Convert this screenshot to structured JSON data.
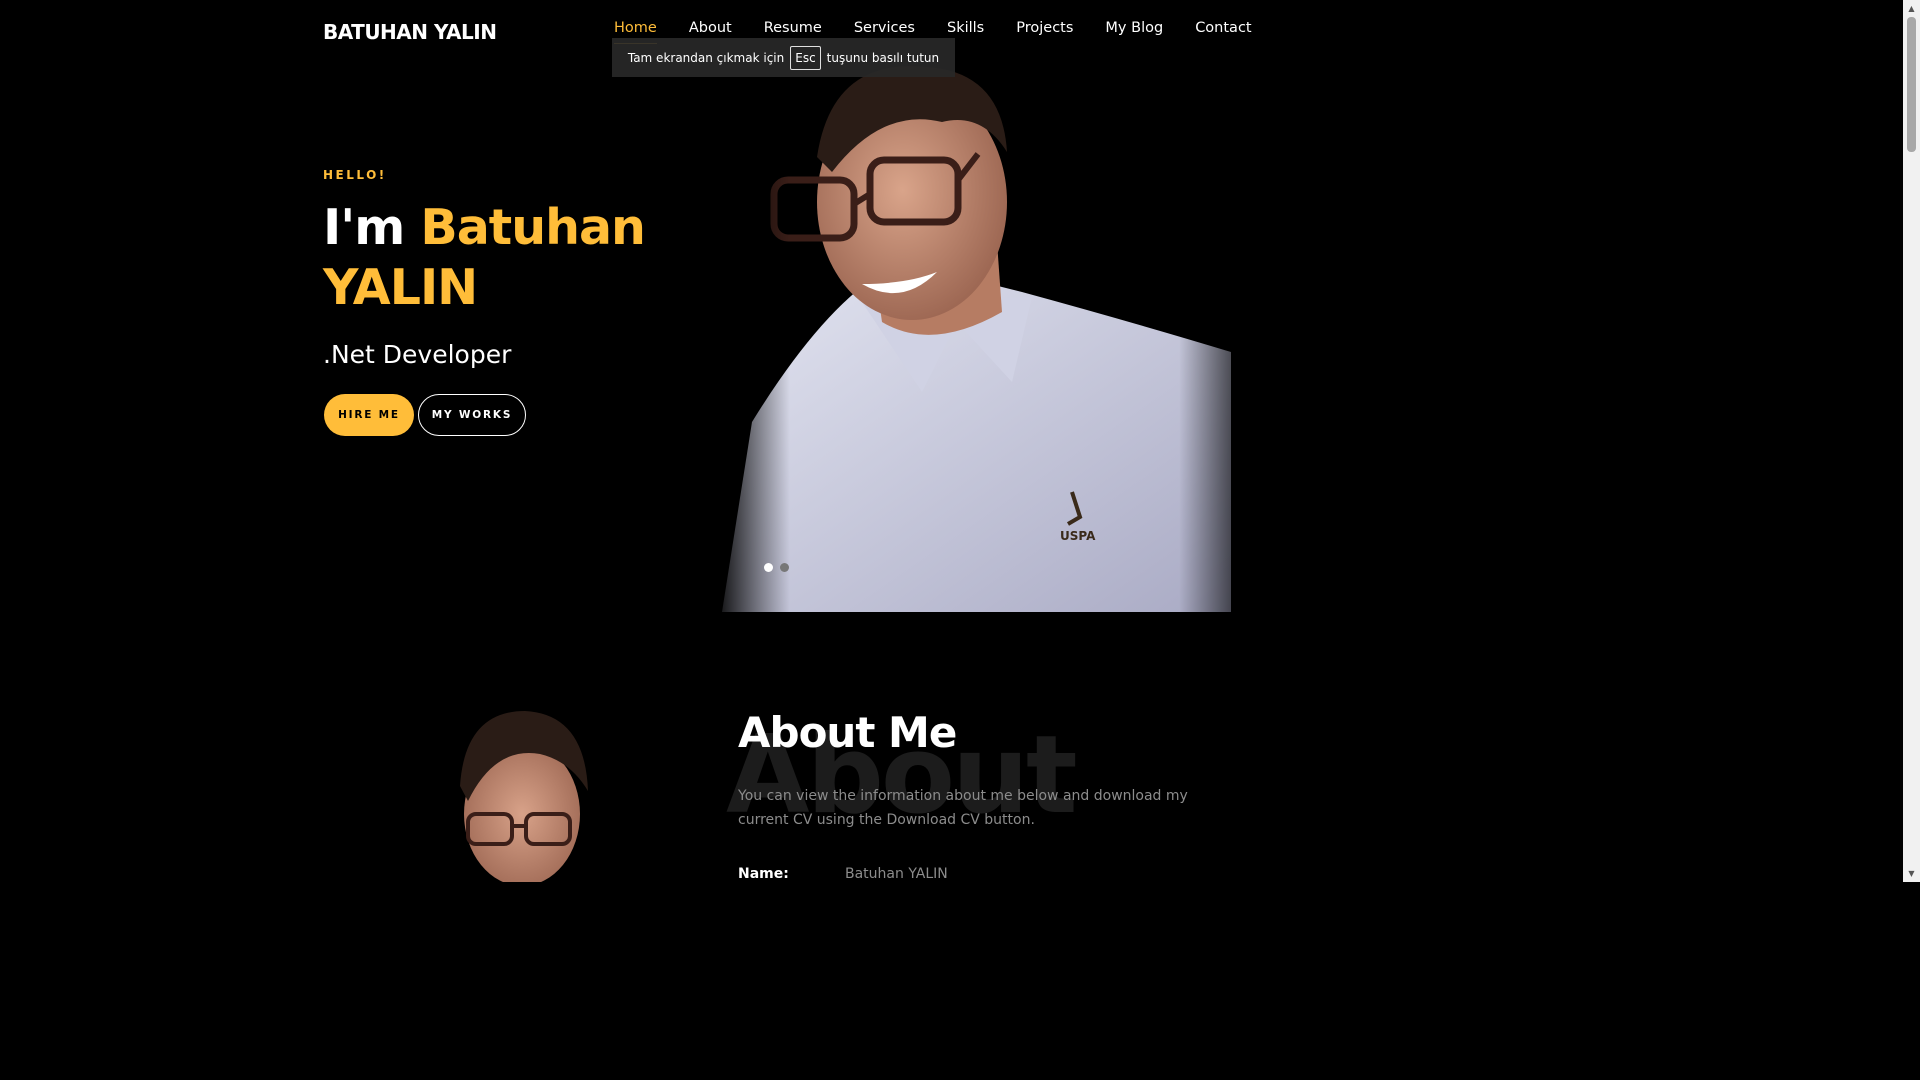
{
  "brand": "BATUHAN YALIN",
  "nav": {
    "items": [
      "Home",
      "About",
      "Resume",
      "Services",
      "Skills",
      "Projects",
      "My Blog",
      "Contact"
    ],
    "active": "Home"
  },
  "fullscreen_hint": {
    "before": "Tam ekrandan çıkmak için",
    "key": "Esc",
    "after": "tuşunu basılı tutun"
  },
  "hero": {
    "greeting": "HELLO!",
    "title_prefix": "I'm",
    "title_name": "Batuhan YALIN",
    "subtitle": ".Net Developer",
    "hire_label": "HIRE ME",
    "works_label": "MY WORKS",
    "slider_dots": 2,
    "active_dot": 0
  },
  "about": {
    "bg_word": "About",
    "title": "About Me",
    "text": "You can view the information about me below and download my current CV using the Download CV button.",
    "name_label": "Name:",
    "name_value": "Batuhan YALIN"
  },
  "colors": {
    "accent": "#ffbd39",
    "background": "#000000",
    "muted_text": "#8c8c8c"
  }
}
